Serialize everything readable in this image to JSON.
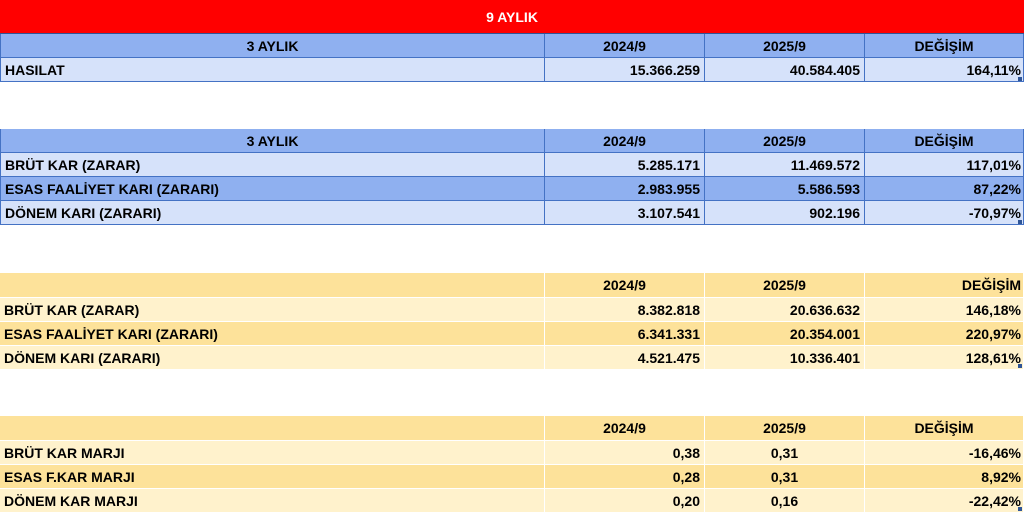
{
  "title": "9 AYLIK",
  "revenue_table": {
    "header": [
      "3 AYLIK",
      "2024/9",
      "2025/9",
      "DEĞİŞİM"
    ],
    "rows": [
      {
        "label": "HASILAT",
        "v2024": "15.366.259",
        "v2025": "40.584.405",
        "change": "164,11%"
      }
    ]
  },
  "quarter_profit_table": {
    "header": [
      "3 AYLIK",
      "2024/9",
      "2025/9",
      "DEĞİŞİM"
    ],
    "rows": [
      {
        "label": "BRÜT KAR (ZARAR)",
        "v2024": "5.285.171",
        "v2025": "11.469.572",
        "change": "117,01%"
      },
      {
        "label": "ESAS FAALİYET KARI (ZARARI)",
        "v2024": "2.983.955",
        "v2025": "5.586.593",
        "change": "87,22%"
      },
      {
        "label": "DÖNEM KARI (ZARARI)",
        "v2024": "3.107.541",
        "v2025": "902.196",
        "change": "-70,97%"
      }
    ]
  },
  "ninemonth_profit_table": {
    "header": [
      "",
      "2024/9",
      "2025/9",
      "DEĞİŞİM"
    ],
    "rows": [
      {
        "label": "BRÜT KAR (ZARAR)",
        "v2024": "8.382.818",
        "v2025": "20.636.632",
        "change": "146,18%"
      },
      {
        "label": "ESAS FAALİYET KARI (ZARARI)",
        "v2024": "6.341.331",
        "v2025": "20.354.001",
        "change": "220,97%"
      },
      {
        "label": "DÖNEM KARI (ZARARI)",
        "v2024": "4.521.475",
        "v2025": "10.336.401",
        "change": "128,61%"
      }
    ]
  },
  "margin_table": {
    "header": [
      "",
      "2024/9",
      "2025/9",
      "DEĞİŞİM"
    ],
    "rows": [
      {
        "label": "BRÜT KAR MARJI",
        "v2024": "0,38",
        "v2025": "0,31",
        "change": "-16,46%"
      },
      {
        "label": "ESAS F.KAR MARJI",
        "v2024": "0,28",
        "v2025": "0,31",
        "change": "8,92%"
      },
      {
        "label": "DÖNEM KAR MARJI",
        "v2024": "0,20",
        "v2025": "0,16",
        "change": "-22,42%"
      }
    ]
  },
  "colors": {
    "title_bg": "#ff0000",
    "blue_header": "#8fb0f0",
    "blue_light": "#d6e2fa",
    "yellow_header": "#fde29a",
    "yellow_light": "#fff2cc"
  }
}
